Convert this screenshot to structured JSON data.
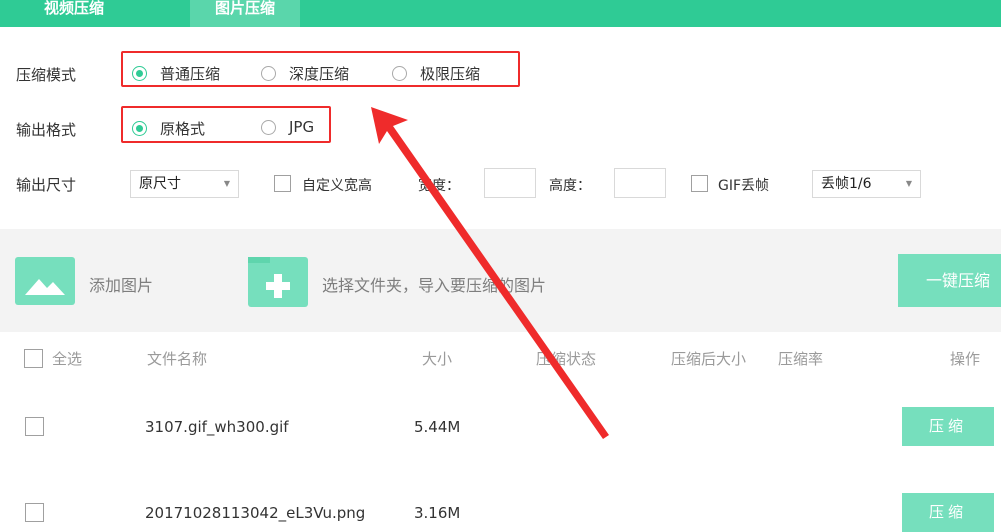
{
  "tabs": [
    {
      "label": "视频压缩"
    },
    {
      "label": "图片压缩"
    }
  ],
  "compress_mode": {
    "label": "压缩模式",
    "options": [
      "普通压缩",
      "深度压缩",
      "极限压缩"
    ],
    "selected": "普通压缩"
  },
  "output_format": {
    "label": "输出格式",
    "options": [
      "原格式",
      "JPG"
    ],
    "selected": "原格式"
  },
  "output_size": {
    "label": "输出尺寸",
    "size_select_value": "原尺寸",
    "custom_label": "自定义宽高",
    "width_label": "宽度：",
    "height_label": "高度：",
    "gif_label": "GIF丢帧",
    "frame_select_value": "丢帧1/6"
  },
  "add_bar": {
    "add_image": "添加图片",
    "add_folder": "选择文件夹，导入要压缩的图片",
    "one_key": "一键压缩"
  },
  "table": {
    "headers": {
      "select_all": "全选",
      "name": "文件名称",
      "size": "大小",
      "status": "压缩状态",
      "after_size": "压缩后大小",
      "rate": "压缩率",
      "action": "操作"
    },
    "rows": [
      {
        "name": "3107.gif_wh300.gif",
        "size": "5.44M",
        "action": "压缩"
      },
      {
        "name": "20171028113042_eL3Vu.png",
        "size": "3.16M",
        "action": "压缩"
      }
    ]
  },
  "colors": {
    "accent": "#2fcb95",
    "accent_light": "#76dfbd",
    "annotation_red": "#ef2b2b"
  }
}
